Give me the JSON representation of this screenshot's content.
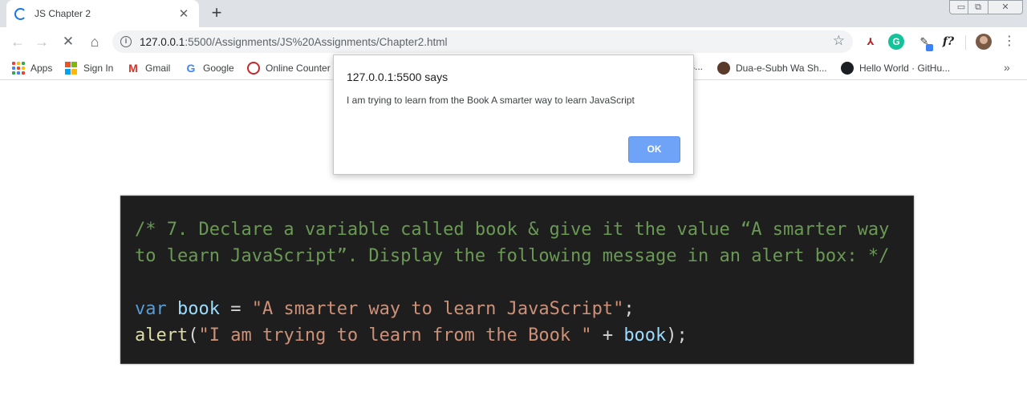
{
  "browser": {
    "tab": {
      "title": "JS Chapter 2"
    },
    "new_tab_label": "+",
    "window_controls": {
      "minimize": "▭",
      "maximize": "⧉",
      "close": "✕"
    },
    "address": {
      "host": "127.0.0.1",
      "path": ":5500/Assignments/JS%20Assignments/Chapter2.html"
    },
    "toolbar_icons": [
      "back-arrow",
      "forward-arrow",
      "stop-loading",
      "home",
      "site-info",
      "bookmark-star",
      "pdf-extension",
      "grammarly-extension",
      "color-picker-extension",
      "formula-extension",
      "profile-avatar",
      "chrome-menu"
    ],
    "bookmarks": [
      {
        "label": "Apps",
        "icon": "apps-grid-icon"
      },
      {
        "label": "Sign In",
        "icon": "microsoft-icon"
      },
      {
        "label": "Gmail",
        "icon": "gmail-icon"
      },
      {
        "label": "Google",
        "icon": "google-icon"
      },
      {
        "label": "Online Counter",
        "icon": "online-counter-icon"
      },
      {
        "label": "Dua-e-Subh Wa Sh...",
        "icon": "dua-icon"
      },
      {
        "label": "Hello World · GitHu...",
        "icon": "github-icon"
      }
    ],
    "bookmarks_partial_hidden": "s...",
    "bookmarks_overflow": "»"
  },
  "alert": {
    "title": "127.0.0.1:5500 says",
    "message": "I am trying to learn from the Book A smarter way to learn JavaScript",
    "ok_label": "OK"
  },
  "code": {
    "comment_line_1": "/* 7. Declare a variable called book & give it the value “A smarter way",
    "comment_line_2": "to learn JavaScript”. Display the following message in an alert box: */",
    "line_4": {
      "keyword": "var",
      "variable": "book",
      "operator": "=",
      "string": "\"A smarter way to learn JavaScript\"",
      "end": ";"
    },
    "line_5": {
      "function": "alert",
      "open": "(",
      "string": "\"I am trying to learn from the Book \"",
      "operator": "+",
      "variable": "book",
      "close": ");"
    }
  },
  "colors": {
    "code_background": "#1e1e1e",
    "comment": "#6a9955",
    "keyword": "#569cd6",
    "variable": "#9cdcfe",
    "string": "#ce9178",
    "function": "#dcdcaa",
    "ok_button": "#6ea3f7"
  }
}
